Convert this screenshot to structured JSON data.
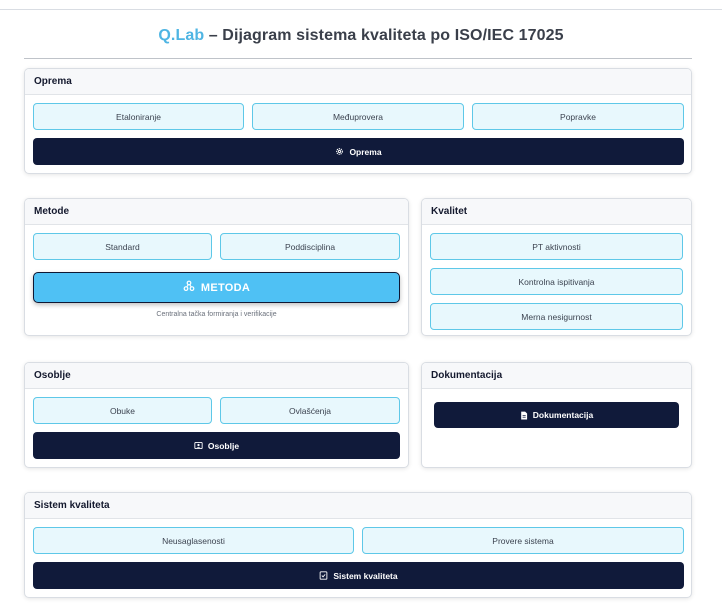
{
  "header": {
    "brand": "Q.Lab",
    "title": " – Dijagram sistema kvaliteta po ISO/IEC 17025"
  },
  "oprema": {
    "title": "Oprema",
    "buttons": [
      "Etaloniranje",
      "Međuprovera",
      "Popravke"
    ],
    "main_label": "Oprema",
    "main_icon": "gear-icon"
  },
  "metode": {
    "title": "Metode",
    "buttons": [
      "Standard",
      "Poddisciplina"
    ],
    "main_label": "METODA",
    "main_icon": "nodes-icon",
    "caption": "Centralna tačka formiranja i verifikacije"
  },
  "kvalitet": {
    "title": "Kvalitet",
    "buttons": [
      "PT aktivnosti",
      "Kontrolna ispitivanja",
      "Merna nesigurnost"
    ]
  },
  "osoblje": {
    "title": "Osoblje",
    "buttons": [
      "Obuke",
      "Ovlašćenja"
    ],
    "main_label": "Osoblje",
    "main_icon": "person-badge-icon"
  },
  "dokumentacija": {
    "title": "Dokumentacija",
    "main_label": "Dokumentacija",
    "main_icon": "document-icon"
  },
  "sistem": {
    "title": "Sistem kvaliteta",
    "buttons": [
      "Neusaglasenosti",
      "Provere sistema"
    ],
    "main_label": "Sistem kvaliteta",
    "main_icon": "checklist-icon"
  },
  "colors": {
    "accent": "#4fc1f4",
    "dark": "#101a3a",
    "light_button": "#e8f8fd",
    "light_border": "#5ec8e8"
  }
}
